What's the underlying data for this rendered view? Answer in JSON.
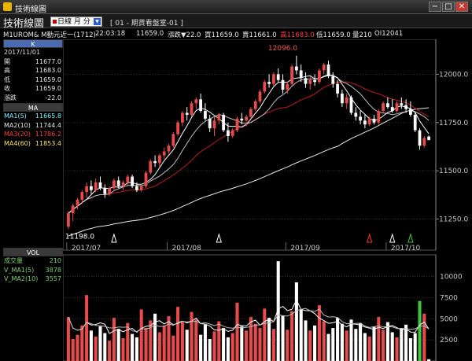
{
  "window": {
    "title": "技術線圖",
    "minimize": "−",
    "maximize": "□",
    "close": "✕"
  },
  "toolbar": {
    "brand": "技術線圖",
    "period": "日線 月 分",
    "doc": "[ 01 - 期貨看盤室-01 ]"
  },
  "quote": {
    "symbol": "M1UROM&  M勤元近一(1712)",
    "time": "22:03:18",
    "price": "11659.0",
    "change": "漲跌▼22.0",
    "buy": "買11659.0",
    "sell": "賣11661.0",
    "high": "高11683.0",
    "low": "低11659.0",
    "volume": "量210",
    "oi": "OI12041"
  },
  "panel": {
    "k_title": "K",
    "date": "2017/11/01",
    "ohlc": [
      {
        "label": "開",
        "value": "11677.0"
      },
      {
        "label": "高",
        "value": "11683.0"
      },
      {
        "label": "低",
        "value": "11659.0"
      },
      {
        "label": "收",
        "value": "11659.0"
      },
      {
        "label": "漲跌",
        "value": "-22.0"
      }
    ],
    "ma_title": "MA",
    "ma": [
      {
        "label": "MA1(5)",
        "value": "11665.8",
        "color": "#7ef4ff"
      },
      {
        "label": "MA2(10)",
        "value": "11744.4",
        "color": "#e6e6e6"
      },
      {
        "label": "MA3(20)",
        "value": "11786.2",
        "color": "#ff3b3b"
      },
      {
        "label": "MA4(60)",
        "value": "11853.4",
        "color": "#ffe26a"
      }
    ],
    "vol_title": "VOL",
    "vol": [
      {
        "label": "成交量",
        "value": "210",
        "color": "#7dd36e"
      },
      {
        "label": "V_MA1(5)",
        "value": "3878",
        "color": "#7dd36e"
      },
      {
        "label": "V_MA2(10)",
        "value": "3557",
        "color": "#7dd36e"
      }
    ]
  },
  "colors": {
    "up": "#e94b4b",
    "down": "#ffffff",
    "ma5": "#ffffff",
    "ma10": "#bfbfbf",
    "ma20": "#c01818",
    "ma60": "#e8e8e8",
    "grid": "#333333",
    "axis": "#c8c8c8",
    "markers": "#ff3030",
    "markers_alt": "#3cc83c",
    "markers_white": "#ffffff"
  },
  "chart_data": [
    {
      "type": "candlestick",
      "title": "",
      "x_labels": [
        "2017/07",
        "2017/08",
        "2017/09",
        "2017/10"
      ],
      "y_ticks": [
        "12000.0",
        "11750.0",
        "11500.0",
        "11250.0"
      ],
      "ylim": [
        11130,
        12140
      ],
      "annotations": {
        "peak": "12096.0",
        "trough": "11198.0"
      },
      "candles": [
        {
          "o": 11210,
          "h": 11290,
          "l": 11198,
          "c": 11280
        },
        {
          "o": 11280,
          "h": 11330,
          "l": 11240,
          "c": 11320
        },
        {
          "o": 11320,
          "h": 11360,
          "l": 11300,
          "c": 11350
        },
        {
          "o": 11350,
          "h": 11400,
          "l": 11330,
          "c": 11390
        },
        {
          "o": 11390,
          "h": 11440,
          "l": 11360,
          "c": 11420
        },
        {
          "o": 11420,
          "h": 11450,
          "l": 11380,
          "c": 11400
        },
        {
          "o": 11400,
          "h": 11460,
          "l": 11390,
          "c": 11440
        },
        {
          "o": 11440,
          "h": 11470,
          "l": 11400,
          "c": 11410
        },
        {
          "o": 11410,
          "h": 11430,
          "l": 11360,
          "c": 11380
        },
        {
          "o": 11380,
          "h": 11420,
          "l": 11370,
          "c": 11410
        },
        {
          "o": 11410,
          "h": 11460,
          "l": 11400,
          "c": 11450
        },
        {
          "o": 11450,
          "h": 11470,
          "l": 11410,
          "c": 11420
        },
        {
          "o": 11420,
          "h": 11450,
          "l": 11400,
          "c": 11440
        },
        {
          "o": 11440,
          "h": 11480,
          "l": 11420,
          "c": 11470
        },
        {
          "o": 11470,
          "h": 11480,
          "l": 11410,
          "c": 11420
        },
        {
          "o": 11420,
          "h": 11440,
          "l": 11390,
          "c": 11400
        },
        {
          "o": 11400,
          "h": 11430,
          "l": 11390,
          "c": 11420
        },
        {
          "o": 11420,
          "h": 11500,
          "l": 11410,
          "c": 11490
        },
        {
          "o": 11490,
          "h": 11560,
          "l": 11480,
          "c": 11550
        },
        {
          "o": 11550,
          "h": 11580,
          "l": 11520,
          "c": 11540
        },
        {
          "o": 11540,
          "h": 11590,
          "l": 11520,
          "c": 11580
        },
        {
          "o": 11580,
          "h": 11620,
          "l": 11560,
          "c": 11600
        },
        {
          "o": 11600,
          "h": 11640,
          "l": 11590,
          "c": 11630
        },
        {
          "o": 11630,
          "h": 11700,
          "l": 11620,
          "c": 11690
        },
        {
          "o": 11690,
          "h": 11760,
          "l": 11680,
          "c": 11750
        },
        {
          "o": 11750,
          "h": 11810,
          "l": 11730,
          "c": 11800
        },
        {
          "o": 11800,
          "h": 11830,
          "l": 11760,
          "c": 11790
        },
        {
          "o": 11790,
          "h": 11860,
          "l": 11780,
          "c": 11850
        },
        {
          "o": 11850,
          "h": 11880,
          "l": 11820,
          "c": 11870
        },
        {
          "o": 11870,
          "h": 11900,
          "l": 11800,
          "c": 11810
        },
        {
          "o": 11810,
          "h": 11850,
          "l": 11760,
          "c": 11770
        },
        {
          "o": 11770,
          "h": 11790,
          "l": 11700,
          "c": 11720
        },
        {
          "o": 11720,
          "h": 11780,
          "l": 11680,
          "c": 11760
        },
        {
          "o": 11760,
          "h": 11800,
          "l": 11740,
          "c": 11790
        },
        {
          "o": 11790,
          "h": 11800,
          "l": 11700,
          "c": 11710
        },
        {
          "o": 11710,
          "h": 11750,
          "l": 11650,
          "c": 11680
        },
        {
          "o": 11680,
          "h": 11720,
          "l": 11670,
          "c": 11710
        },
        {
          "o": 11710,
          "h": 11780,
          "l": 11700,
          "c": 11770
        },
        {
          "o": 11770,
          "h": 11800,
          "l": 11740,
          "c": 11760
        },
        {
          "o": 11760,
          "h": 11790,
          "l": 11730,
          "c": 11780
        },
        {
          "o": 11780,
          "h": 11830,
          "l": 11770,
          "c": 11820
        },
        {
          "o": 11820,
          "h": 11870,
          "l": 11810,
          "c": 11860
        },
        {
          "o": 11860,
          "h": 11920,
          "l": 11850,
          "c": 11910
        },
        {
          "o": 11910,
          "h": 11970,
          "l": 11900,
          "c": 11960
        },
        {
          "o": 11960,
          "h": 12000,
          "l": 11930,
          "c": 11950
        },
        {
          "o": 11950,
          "h": 12010,
          "l": 11940,
          "c": 12000
        },
        {
          "o": 12000,
          "h": 12030,
          "l": 11960,
          "c": 11970
        },
        {
          "o": 11970,
          "h": 12000,
          "l": 11900,
          "c": 11920
        },
        {
          "o": 11920,
          "h": 11960,
          "l": 11900,
          "c": 11950
        },
        {
          "o": 11950,
          "h": 12050,
          "l": 11940,
          "c": 12040
        },
        {
          "o": 12040,
          "h": 12096,
          "l": 12000,
          "c": 12020
        },
        {
          "o": 12020,
          "h": 12050,
          "l": 11960,
          "c": 11980
        },
        {
          "o": 11980,
          "h": 12010,
          "l": 11930,
          "c": 11950
        },
        {
          "o": 11950,
          "h": 11990,
          "l": 11920,
          "c": 11970
        },
        {
          "o": 11970,
          "h": 12000,
          "l": 11940,
          "c": 11960
        },
        {
          "o": 11960,
          "h": 12030,
          "l": 11950,
          "c": 12020
        },
        {
          "o": 12020,
          "h": 12060,
          "l": 12000,
          "c": 12050
        },
        {
          "o": 12050,
          "h": 12070,
          "l": 11980,
          "c": 11990
        },
        {
          "o": 11990,
          "h": 12010,
          "l": 11930,
          "c": 11950
        },
        {
          "o": 11950,
          "h": 11970,
          "l": 11880,
          "c": 11900
        },
        {
          "o": 11900,
          "h": 11920,
          "l": 11830,
          "c": 11850
        },
        {
          "o": 11850,
          "h": 11900,
          "l": 11820,
          "c": 11880
        },
        {
          "o": 11880,
          "h": 11890,
          "l": 11790,
          "c": 11800
        },
        {
          "o": 11800,
          "h": 11830,
          "l": 11760,
          "c": 11780
        },
        {
          "o": 11780,
          "h": 11810,
          "l": 11740,
          "c": 11760
        },
        {
          "o": 11760,
          "h": 11790,
          "l": 11720,
          "c": 11740
        },
        {
          "o": 11740,
          "h": 11780,
          "l": 11730,
          "c": 11770
        },
        {
          "o": 11770,
          "h": 11790,
          "l": 11740,
          "c": 11750
        },
        {
          "o": 11750,
          "h": 11820,
          "l": 11740,
          "c": 11810
        },
        {
          "o": 11810,
          "h": 11860,
          "l": 11800,
          "c": 11850
        },
        {
          "o": 11850,
          "h": 11880,
          "l": 11820,
          "c": 11830
        },
        {
          "o": 11830,
          "h": 11870,
          "l": 11800,
          "c": 11810
        },
        {
          "o": 11810,
          "h": 11860,
          "l": 11800,
          "c": 11850
        },
        {
          "o": 11850,
          "h": 11880,
          "l": 11820,
          "c": 11840
        },
        {
          "o": 11840,
          "h": 11870,
          "l": 11800,
          "c": 11820
        },
        {
          "o": 11820,
          "h": 11860,
          "l": 11780,
          "c": 11790
        },
        {
          "o": 11790,
          "h": 11800,
          "l": 11700,
          "c": 11710
        },
        {
          "o": 11710,
          "h": 11720,
          "l": 11610,
          "c": 11630
        },
        {
          "o": 11630,
          "h": 11680,
          "l": 11620,
          "c": 11670
        },
        {
          "o": 11677,
          "h": 11683,
          "l": 11659,
          "c": 11659
        }
      ]
    },
    {
      "type": "bar",
      "title": "VOL",
      "y_ticks": [
        "10000",
        "7500",
        "5000",
        "2500"
      ],
      "ylim": [
        0,
        12000
      ],
      "volume": [
        5200,
        2600,
        3100,
        4200,
        7800,
        3600,
        2900,
        4100,
        3300,
        2400,
        5100,
        3800,
        2700,
        4500,
        3200,
        2800,
        6100,
        3900,
        4800,
        5600,
        3400,
        4200,
        5300,
        3000,
        6400,
        4600,
        3700,
        5800,
        4900,
        3100,
        4300,
        2600,
        3500,
        4700,
        3900,
        2800,
        3300,
        6900,
        4100,
        3600,
        5200,
        4400,
        3900,
        6200,
        5100,
        3800,
        11800,
        5400,
        3700,
        5900,
        9300,
        6100,
        4800,
        3600,
        4200,
        6600,
        4700,
        3200,
        3900,
        5100,
        4400,
        3600,
        4900,
        3800,
        4500,
        3300,
        2900,
        4100,
        5200,
        3700,
        4600,
        3400,
        2800,
        3900,
        4300,
        2700,
        3300,
        7100,
        5600,
        210
      ]
    }
  ]
}
